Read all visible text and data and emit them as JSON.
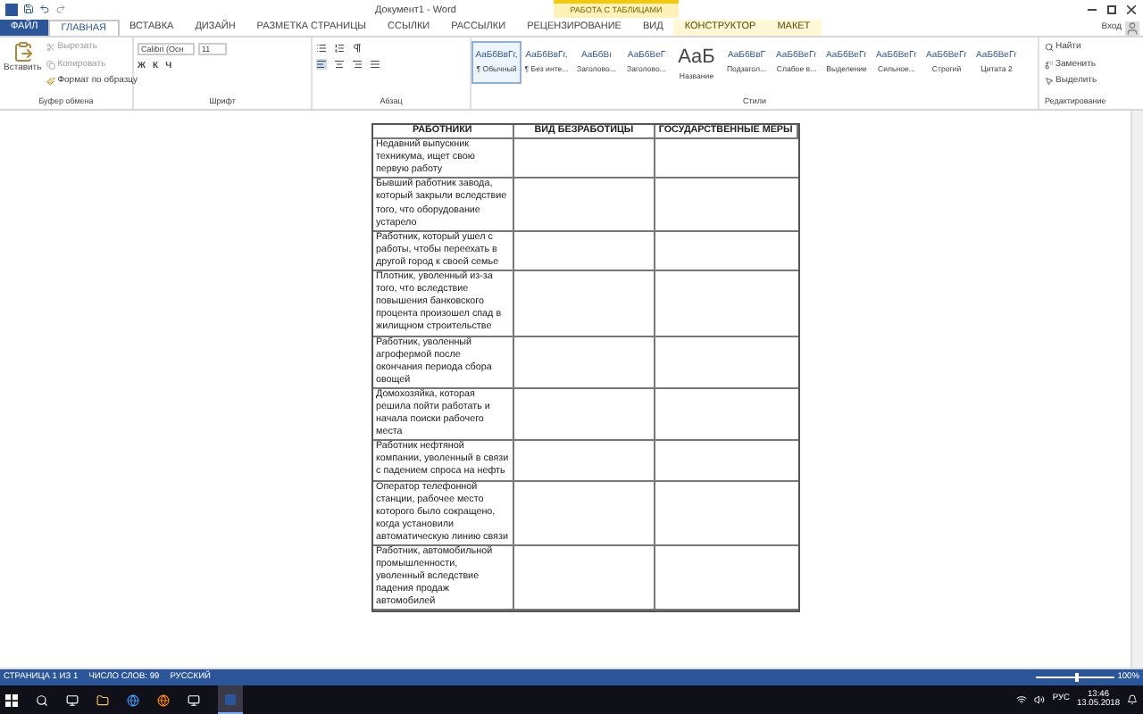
{
  "window": {
    "title": "Документ1 - Word",
    "context_group": "РАБОТА С ТАБЛИЦАМИ",
    "signin": "Вход"
  },
  "tabs": [
    {
      "label": "ФАЙЛ",
      "selected": false,
      "kind": "file"
    },
    {
      "label": "ГЛАВНАЯ",
      "selected": true,
      "kind": "normal"
    },
    {
      "label": "ВСТАВКА",
      "selected": false,
      "kind": "normal"
    },
    {
      "label": "ДИЗАЙН",
      "selected": false,
      "kind": "normal"
    },
    {
      "label": "РАЗМЕТКА СТРАНИЦЫ",
      "selected": false,
      "kind": "normal"
    },
    {
      "label": "ССЫЛКИ",
      "selected": false,
      "kind": "normal"
    },
    {
      "label": "РАССЫЛКИ",
      "selected": false,
      "kind": "normal"
    },
    {
      "label": "РЕЦЕНЗИРОВАНИЕ",
      "selected": false,
      "kind": "normal"
    },
    {
      "label": "ВИД",
      "selected": false,
      "kind": "normal"
    },
    {
      "label": "КОНСТРУКТОР",
      "selected": false,
      "kind": "context"
    },
    {
      "label": "МАКЕТ",
      "selected": false,
      "kind": "context"
    }
  ],
  "clipboard": {
    "paste": "Вставить",
    "cut": "Вырезать",
    "copy": "Копировать",
    "format_painter": "Формат по образцу",
    "group": "Буфер обмена"
  },
  "font": {
    "name": "Calibri (Осн",
    "size": "11",
    "format_buttons": [
      "Ж",
      "К",
      "Ч"
    ],
    "group": "Шрифт"
  },
  "paragraph": {
    "group": "Абзац"
  },
  "styles": {
    "group": "Стили",
    "items": [
      {
        "preview": "АаБбВвГг,",
        "name": "¶ Обычный",
        "selected": true
      },
      {
        "preview": "АаБбВвГг,",
        "name": "¶ Без инте...",
        "selected": false
      },
      {
        "preview": "АаБбВı",
        "name": "Заголово...",
        "selected": false
      },
      {
        "preview": "АаБбВеГ",
        "name": "Заголово...",
        "selected": false
      },
      {
        "preview": "АаБ",
        "name": "Название",
        "selected": false
      },
      {
        "preview": "АаБбВвГ",
        "name": "Подзагол...",
        "selected": false
      },
      {
        "preview": "АаБбВеГг",
        "name": "Слабое в...",
        "selected": false
      },
      {
        "preview": "АаБбВеГг",
        "name": "Выделение",
        "selected": false
      },
      {
        "preview": "АаБбВеГг",
        "name": "Сильное...",
        "selected": false
      },
      {
        "preview": "АаБбВеГг",
        "name": "Строгий",
        "selected": false
      },
      {
        "preview": "АаБбВеГг",
        "name": "Цитата 2",
        "selected": false
      }
    ]
  },
  "editing": {
    "find": "Найти",
    "replace": "Заменить",
    "select": "Выделить",
    "group": "Редактирование"
  },
  "table": {
    "columns": [
      "РАБОТНИКИ",
      "ВИД БЕЗРАБОТИЦЫ",
      "ГОСУДАРСТВЕННЫЕ МЕРЫ"
    ],
    "rows": [
      "Недавний выпускник техникума, ищет свою первую работу",
      "Бывший работник завода, который закрыли вследствие того, что оборудование устарело",
      "Работник, который ушел с работы, чтобы переехать в другой город к своей семье",
      "Плотник, уволенный из-за того, что вследствие повышения банковского процента произошел спад в жилищном строительстве",
      "Работник, уволенный агрофермой после окончания периода сбора овощей",
      "Домохозяйка, которая решила пойти работать и начала поиски рабочего места",
      "Работник нефтяной компании, уволенный в связи с падением спроса на нефть",
      "Оператор телефонной станции, рабочее место которого было сокращено, когда установили автоматическую линию связи",
      "Работник, автомобильной промышленности, уволенный вследствие падения продаж автомобилей"
    ]
  },
  "status_bar": {
    "page": "СТРАНИЦА 1 ИЗ 1",
    "words": "ЧИСЛО СЛОВ: 99",
    "language": "РУССКИЙ",
    "zoom": "100%",
    "zoom_slider": {
      "level": 0.5
    }
  },
  "taskbar": {
    "language": "РУС",
    "time": "13:46",
    "date": "13.05.2018"
  }
}
